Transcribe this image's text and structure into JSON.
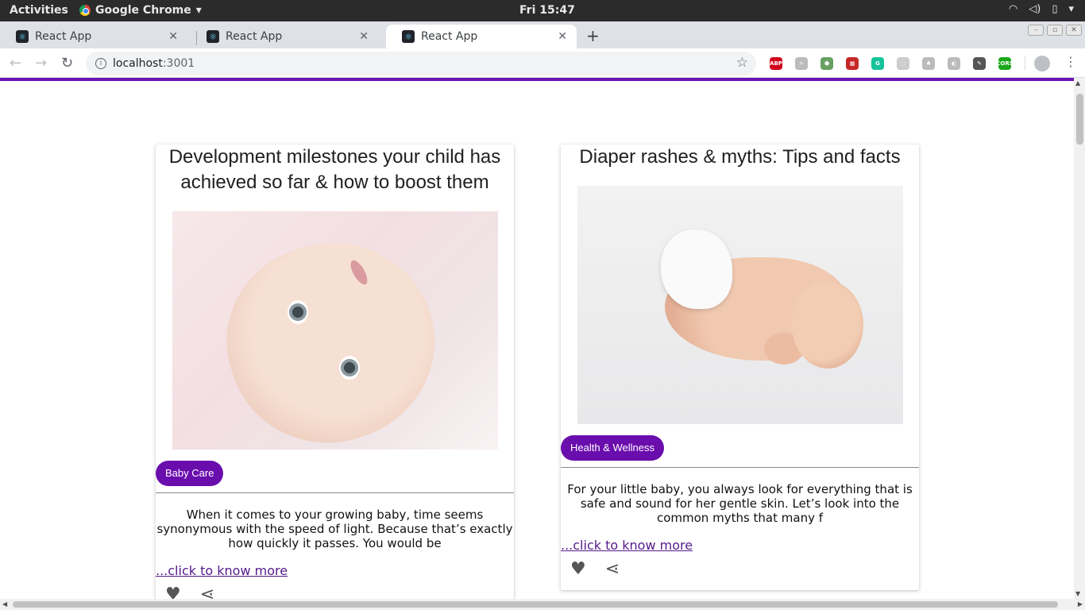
{
  "system_bar": {
    "activities": "Activities",
    "app_name": "Google Chrome",
    "clock": "Fri 15:47"
  },
  "browser": {
    "tabs": [
      {
        "label": "React App"
      },
      {
        "label": "React App"
      },
      {
        "label": "React App"
      }
    ],
    "address": {
      "host": "localhost",
      "port": ":3001"
    },
    "extensions": [
      {
        "name": "adblock-icon",
        "text": "ABP",
        "color": "#d0021b"
      },
      {
        "name": "react-devtools-icon",
        "text": "⚛",
        "color": "#bbbbbb"
      },
      {
        "name": "nodejs-icon",
        "text": "⬢",
        "color": "#68a063"
      },
      {
        "name": "extension-red-icon",
        "text": "▦",
        "color": "#c62828"
      },
      {
        "name": "grammarly-icon",
        "text": "G",
        "color": "#15c39a"
      },
      {
        "name": "extension-gray-icon",
        "text": "◌",
        "color": "#cccccc"
      },
      {
        "name": "extension-tree-icon",
        "text": "♣",
        "color": "#bbbbbb"
      },
      {
        "name": "extension-circle-icon",
        "text": "◐",
        "color": "#bbbbbb"
      },
      {
        "name": "eyedropper-icon",
        "text": "✎",
        "color": "#555555"
      },
      {
        "name": "cors-icon",
        "text": "CORS",
        "color": "#1aa81a"
      }
    ]
  },
  "accent_color": "#6a0dad",
  "cards": [
    {
      "title": "Development milestones your child has achieved so far & how to boost them",
      "category": "Baby Care",
      "excerpt": "When it comes to your growing baby, time seems synonymous with the speed of light. Because that’s exactly how quickly it passes. You would be",
      "link": "...click to know more"
    },
    {
      "title": "Diaper rashes & myths: Tips and facts",
      "category": "Health & Wellness",
      "excerpt": "For your little baby, you always look for everything that is safe and sound for her gentle skin. Let’s look into the common myths that many f",
      "link": "...click to know more"
    }
  ]
}
